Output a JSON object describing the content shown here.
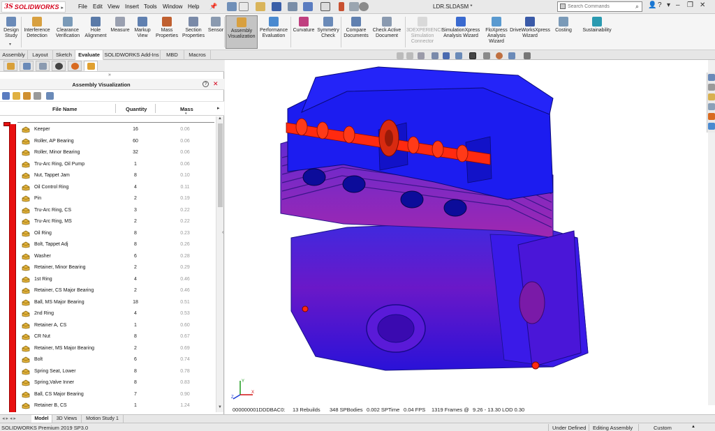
{
  "app": {
    "brand": "SOLIDWORKS",
    "document_title": "LDR.SLDASM *",
    "menus": [
      "File",
      "Edit",
      "View",
      "Insert",
      "Tools",
      "Window",
      "Help"
    ],
    "search_placeholder": "Search Commands"
  },
  "ribbon": {
    "buttons": [
      {
        "label": "Design\nStudy",
        "icon": "design-study-icon"
      },
      {
        "label": "Interference\nDetection",
        "icon": "interference-icon"
      },
      {
        "label": "Clearance\nVerification",
        "icon": "clearance-icon"
      },
      {
        "label": "Hole\nAlignment",
        "icon": "hole-alignment-icon"
      },
      {
        "label": "Measure",
        "icon": "measure-icon"
      },
      {
        "label": "Markup\nView",
        "icon": "markup-icon"
      },
      {
        "label": "Mass\nProperties",
        "icon": "mass-properties-icon"
      },
      {
        "label": "Section\nProperties",
        "icon": "section-properties-icon"
      },
      {
        "label": "Sensor",
        "icon": "sensor-icon"
      },
      {
        "label": "Assembly\nVisualization",
        "icon": "assembly-visualization-icon"
      },
      {
        "label": "Performance\nEvaluation",
        "icon": "performance-icon"
      },
      {
        "label": "Curvature",
        "icon": "curvature-icon"
      },
      {
        "label": "Symmetry\nCheck",
        "icon": "symmetry-icon"
      },
      {
        "label": "Compare\nDocuments",
        "icon": "compare-icon"
      },
      {
        "label": "Check Active\nDocument",
        "icon": "check-document-icon"
      },
      {
        "label": "3DEXPERIENCE\nSimulation\nConnector",
        "icon": "3dexperience-icon"
      },
      {
        "label": "SimulationXpress\nAnalysis Wizard",
        "icon": "simulationxpress-icon"
      },
      {
        "label": "FloXpress\nAnalysis\nWizard",
        "icon": "floxpress-icon"
      },
      {
        "label": "DriveWorksXpress\nWizard",
        "icon": "driveworks-icon"
      },
      {
        "label": "Costing",
        "icon": "costing-icon"
      },
      {
        "label": "Sustainability",
        "icon": "sustainability-icon"
      }
    ]
  },
  "tabs": [
    "Assembly",
    "Layout",
    "Sketch",
    "Evaluate",
    "SOLIDWORKS Add-Ins",
    "MBD",
    "Macros"
  ],
  "active_tab": "Evaluate",
  "assembly_visualization": {
    "title": "Assembly Visualization",
    "columns": {
      "name": "File Name",
      "quantity": "Quantity",
      "mass": "Mass"
    },
    "rows": [
      {
        "name": "Keeper",
        "qty": "16",
        "mass": "0.06"
      },
      {
        "name": "Roller, AP Bearing",
        "qty": "60",
        "mass": "0.06"
      },
      {
        "name": "Roller, Minor Bearing",
        "qty": "32",
        "mass": "0.06"
      },
      {
        "name": "Tru-Arc Ring, Oil Pump",
        "qty": "1",
        "mass": "0.06"
      },
      {
        "name": "Nut, Tappet Jam",
        "qty": "8",
        "mass": "0.10"
      },
      {
        "name": "Oil Control Ring",
        "qty": "4",
        "mass": "0.11"
      },
      {
        "name": "Pin",
        "qty": "2",
        "mass": "0.19"
      },
      {
        "name": "Tru-Arc Ring, CS",
        "qty": "3",
        "mass": "0.22"
      },
      {
        "name": "Tru-Arc Ring, MS",
        "qty": "2",
        "mass": "0.22"
      },
      {
        "name": "Oil Ring",
        "qty": "8",
        "mass": "0.23"
      },
      {
        "name": "Bolt, Tappet Adj",
        "qty": "8",
        "mass": "0.26"
      },
      {
        "name": "Washer",
        "qty": "6",
        "mass": "0.28"
      },
      {
        "name": "Retainer, Minor Bearing",
        "qty": "2",
        "mass": "0.29"
      },
      {
        "name": "1st Ring",
        "qty": "4",
        "mass": "0.46"
      },
      {
        "name": "Retainer, CS Major Bearing",
        "qty": "2",
        "mass": "0.46"
      },
      {
        "name": "Ball, MS Major Bearing",
        "qty": "18",
        "mass": "0.51"
      },
      {
        "name": "2nd Ring",
        "qty": "4",
        "mass": "0.53"
      },
      {
        "name": "Retainer A, CS",
        "qty": "1",
        "mass": "0.60"
      },
      {
        "name": "CR Nut",
        "qty": "8",
        "mass": "0.67"
      },
      {
        "name": "Retainer, MS Major Bearing",
        "qty": "2",
        "mass": "0.69"
      },
      {
        "name": "Bolt",
        "qty": "6",
        "mass": "0.74"
      },
      {
        "name": "Spring Seat, Lower",
        "qty": "8",
        "mass": "0.78"
      },
      {
        "name": "Spring,Valve Inner",
        "qty": "8",
        "mass": "0.83"
      },
      {
        "name": "Ball, CS Major Bearing",
        "qty": "7",
        "mass": "0.90"
      },
      {
        "name": "Retainer B, CS",
        "qty": "1",
        "mass": "1.24"
      }
    ]
  },
  "performance": {
    "id": "000000001DDDBAC0:",
    "rebuilds": "13 Rebuilds",
    "spbodies": "348 SPBodies",
    "sptime": "0.002 SPTime",
    "fps": "0.04 FPS",
    "frames": "1319 Frames @",
    "lod": "9.26 - 13.30 LOD 0.30"
  },
  "bottom_tabs": [
    "Model",
    "3D Views",
    "Motion Study 1"
  ],
  "status": {
    "version": "SOLIDWORKS Premium 2019 SP3.0",
    "defined": "Under Defined",
    "mode": "Editing Assembly",
    "units": "Custom"
  },
  "colors": {
    "accent_red": "#e81010",
    "brand_red": "#d4001a",
    "model_blue": "#1c1cf0",
    "model_purple": "#6a18c8"
  }
}
